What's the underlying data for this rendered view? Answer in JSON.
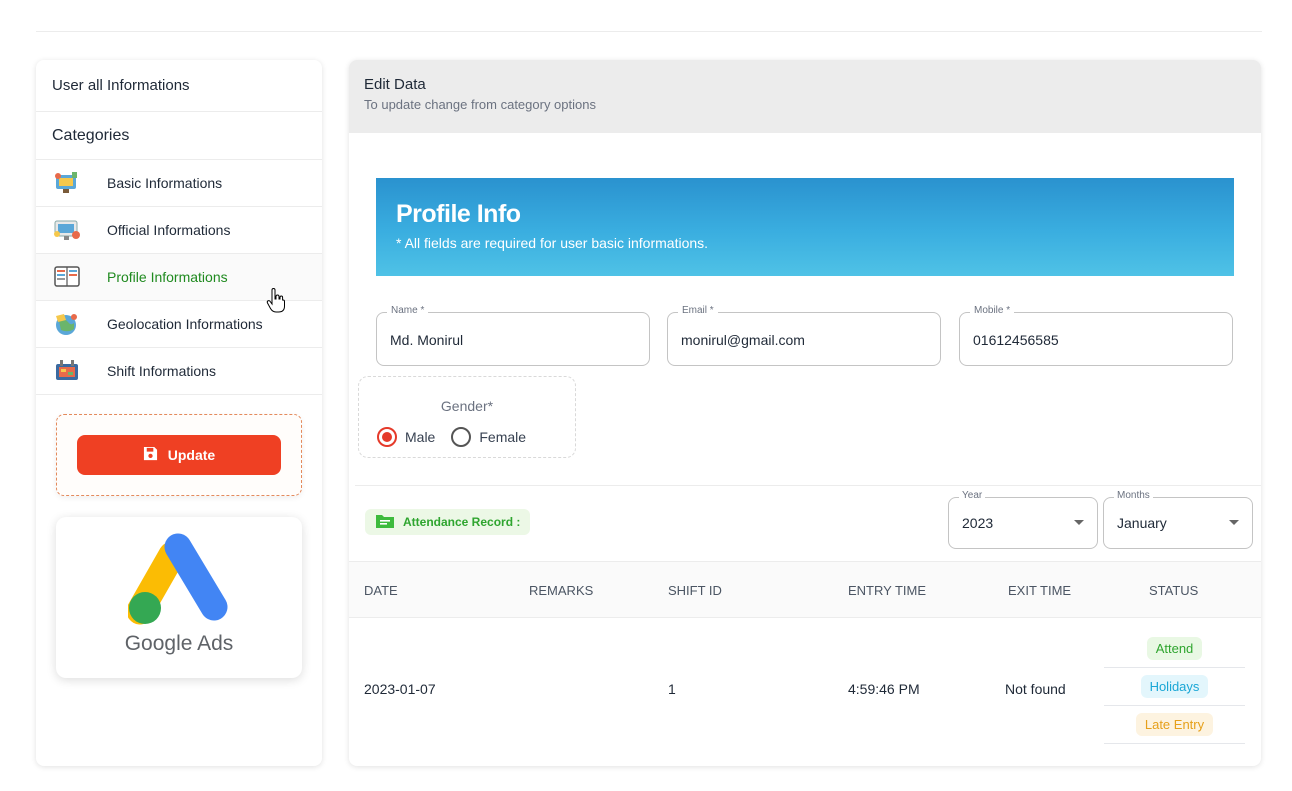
{
  "sidebar": {
    "header": "User all Informations",
    "categories_label": "Categories",
    "items": [
      {
        "label": "Basic Informations",
        "icon": "basic-info-icon"
      },
      {
        "label": "Official Informations",
        "icon": "official-info-icon"
      },
      {
        "label": "Profile Informations",
        "icon": "profile-info-icon",
        "active": true
      },
      {
        "label": "Geolocation Informations",
        "icon": "geolocation-icon"
      },
      {
        "label": "Shift Informations",
        "icon": "shift-info-icon"
      }
    ],
    "update_label": "Update",
    "ad_text": "Google Ads"
  },
  "main": {
    "title": "Edit Data",
    "subtitle": "To update change from category options",
    "banner": {
      "title": "Profile Info",
      "subtitle": "* All fields are required for user basic informations."
    },
    "fields": {
      "name": {
        "label": "Name *",
        "value": "Md. Monirul"
      },
      "email": {
        "label": "Email *",
        "value": "monirul@gmail.com"
      },
      "mobile": {
        "label": "Mobile *",
        "value": "01612456585"
      }
    },
    "gender": {
      "label": "Gender*",
      "options": [
        "Male",
        "Female"
      ],
      "selected": "Male"
    },
    "attendance": {
      "badge": "Attendance Record :",
      "year": {
        "label": "Year",
        "value": "2023"
      },
      "month": {
        "label": "Months",
        "value": "January"
      }
    },
    "table": {
      "headers": [
        "DATE",
        "REMARKS",
        "SHIFT ID",
        "ENTRY TIME",
        "EXIT TIME",
        "STATUS"
      ],
      "rows": [
        {
          "date": "2023-01-07",
          "remarks": "",
          "shift_id": "1",
          "entry_time": "4:59:46 PM",
          "exit_time": "Not found",
          "status": [
            "Attend",
            "Holidays",
            "Late Entry"
          ]
        }
      ]
    }
  },
  "colors": {
    "accent_red": "#ef4023",
    "active_green": "#1f8a1f",
    "banner_blue": "#2a92cf",
    "attend": "#2fa52f",
    "holidays": "#1aa7d6",
    "late": "#e6a01b"
  }
}
